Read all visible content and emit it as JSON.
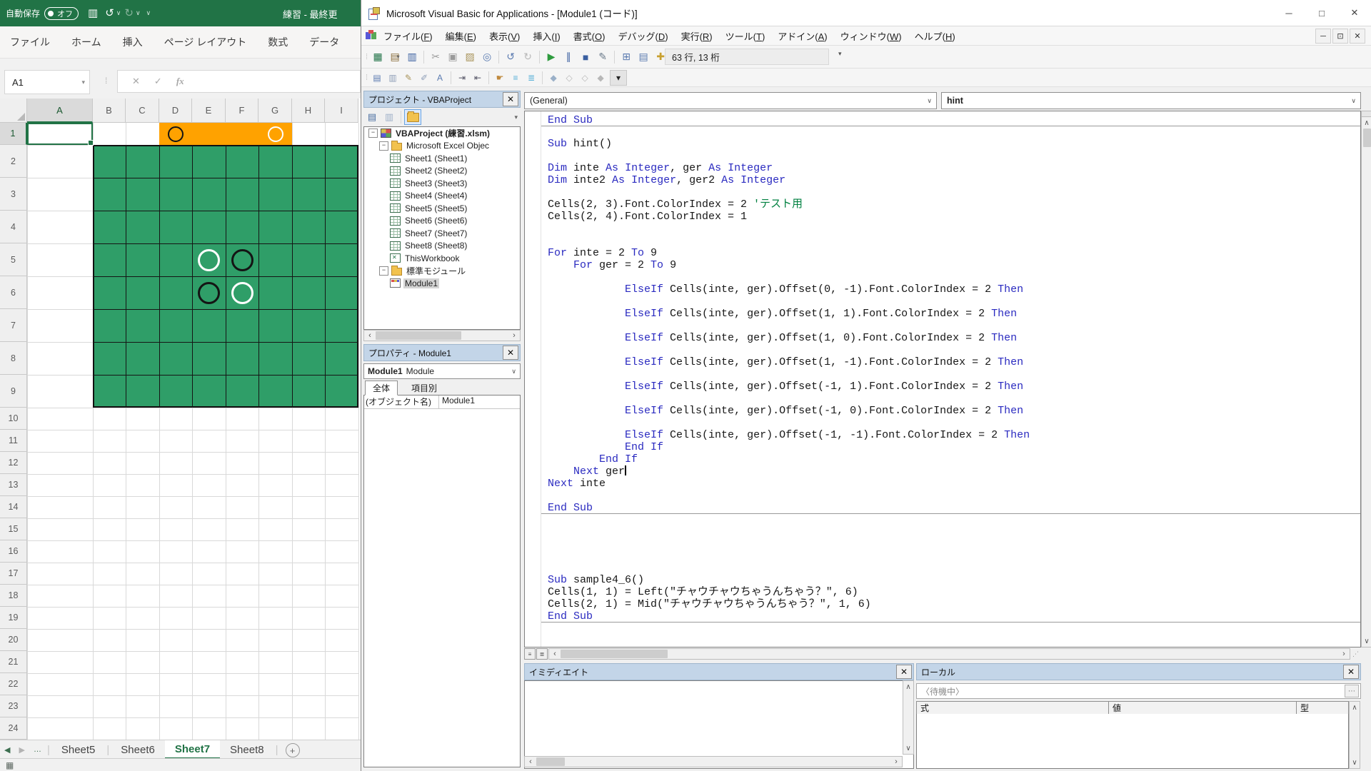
{
  "glyphs": {
    "dropdown": "▾",
    "chev_up": "∧",
    "chev_down": "∨",
    "chev_left": "‹",
    "chev_right": "›",
    "tri_left": "◀",
    "tri_right": "▶",
    "ellipsis": "…",
    "minus": "−",
    "x": "✕",
    "minimize": "─",
    "maximize": "□",
    "restore": "⊡",
    "more": "⋯"
  },
  "excel": {
    "titlebar": {
      "autosave_label": "自動保存",
      "autosave_state": "オフ",
      "title": "練習 - 最終更",
      "icons": [
        {
          "name": "save-icon",
          "glyph": "▥"
        },
        {
          "name": "undo-icon",
          "glyph": "↺"
        },
        {
          "name": "redo-icon",
          "glyph": "↻"
        },
        {
          "name": "toolbar-options-icon",
          "glyph": "▾"
        }
      ]
    },
    "ribbon_tabs": [
      "ファイル",
      "ホーム",
      "挿入",
      "ページ レイアウト",
      "数式",
      "データ"
    ],
    "name_box": "A1",
    "formula_buttons": {
      "cancel": "✕",
      "enter": "✓",
      "fx": "fx"
    },
    "columns": [
      "A",
      "B",
      "C",
      "D",
      "E",
      "F",
      "G",
      "H",
      "I"
    ],
    "row_labels": [
      "1",
      "2",
      "3",
      "4",
      "5",
      "6",
      "7",
      "8",
      "9",
      "10",
      "11",
      "12",
      "13",
      "14",
      "15",
      "16",
      "17",
      "18",
      "19",
      "20",
      "21",
      "22",
      "23",
      "24"
    ],
    "selection": "A1",
    "board": {
      "green_range": "B2:I9",
      "orange_range": "D1:G1",
      "green_color": "#2f9e68",
      "orange_color": "#ffa200",
      "discs": [
        {
          "col": "D",
          "row": 1,
          "color": "black"
        },
        {
          "col": "G",
          "row": 1,
          "color": "white"
        },
        {
          "col": "E",
          "row": 5,
          "color": "white"
        },
        {
          "col": "F",
          "row": 5,
          "color": "black"
        },
        {
          "col": "E",
          "row": 6,
          "color": "black"
        },
        {
          "col": "F",
          "row": 6,
          "color": "white"
        }
      ]
    },
    "sheet_tabs": {
      "overflow": "…",
      "tabs": [
        "Sheet5",
        "Sheet6",
        "Sheet7",
        "Sheet8"
      ],
      "active": "Sheet7"
    },
    "status_icon": "▦"
  },
  "vba": {
    "title": "Microsoft Visual Basic for Applications - [Module1 (コード)]",
    "menus": [
      "ファイル(F)",
      "編集(E)",
      "表示(V)",
      "挿入(I)",
      "書式(O)",
      "デバッグ(D)",
      "実行(R)",
      "ツール(T)",
      "アドイン(A)",
      "ウィンドウ(W)",
      "ヘルプ(H)"
    ],
    "position_indicator": "63 行, 13 桁",
    "toolbar_main": [
      {
        "name": "view-excel-icon",
        "glyph": "▦",
        "color": "#1e7145"
      },
      {
        "name": "insert-object-icon",
        "glyph": "▤",
        "color": "#8a6d3b",
        "dd": true
      },
      {
        "name": "save-icon",
        "glyph": "▥",
        "color": "#3a5fa0"
      },
      {
        "sep": true
      },
      {
        "name": "cut-icon",
        "glyph": "✂",
        "color": "#9a9a9a"
      },
      {
        "name": "copy-icon",
        "glyph": "▣",
        "color": "#9a9a9a"
      },
      {
        "name": "paste-icon",
        "glyph": "▨",
        "color": "#a8935a"
      },
      {
        "name": "find-icon",
        "glyph": "◎",
        "color": "#5a7ab0"
      },
      {
        "sep": true
      },
      {
        "name": "undo-icon",
        "glyph": "↺",
        "color": "#5a7ab0"
      },
      {
        "name": "redo-icon",
        "glyph": "↻",
        "color": "#b8b8b8"
      },
      {
        "sep": true
      },
      {
        "name": "run-icon",
        "glyph": "▶",
        "color": "#2e9b3e"
      },
      {
        "name": "break-icon",
        "glyph": "∥",
        "color": "#3a5fa0"
      },
      {
        "name": "reset-icon",
        "glyph": "■",
        "color": "#3a5fa0"
      },
      {
        "name": "design-mode-icon",
        "glyph": "✎",
        "color": "#6a7a8a"
      },
      {
        "sep": true
      },
      {
        "name": "project-explorer-icon",
        "glyph": "⊞",
        "color": "#5a7ab0"
      },
      {
        "name": "properties-window-icon",
        "glyph": "▤",
        "color": "#5a7ab0"
      },
      {
        "name": "toolbox-icon",
        "glyph": "✚",
        "color": "#c8a030"
      },
      {
        "name": "object-browser-icon",
        "glyph": "✦",
        "color": "#b8b8b8"
      },
      {
        "sep": true
      },
      {
        "name": "help-icon",
        "glyph": "?",
        "round": true
      }
    ],
    "toolbar_edit": [
      {
        "name": "list-properties-icon",
        "glyph": "▤",
        "color": "#5a7ab0"
      },
      {
        "name": "list-constants-icon",
        "glyph": "▥",
        "color": "#8f9fb8"
      },
      {
        "name": "quick-info-icon",
        "glyph": "✎",
        "color": "#a8935a"
      },
      {
        "name": "parameter-info-icon",
        "glyph": "✐",
        "color": "#8f9fb8"
      },
      {
        "name": "complete-word-icon",
        "glyph": "A",
        "color": "#5a7ab0"
      },
      {
        "sep": true
      },
      {
        "name": "indent-icon",
        "glyph": "⇥",
        "color": "#556"
      },
      {
        "name": "outdent-icon",
        "glyph": "⇤",
        "color": "#556"
      },
      {
        "sep": true
      },
      {
        "name": "toggle-breakpoint-icon",
        "glyph": "☛",
        "color": "#c08a3e"
      },
      {
        "name": "comment-block-icon",
        "glyph": "≡",
        "color": "#58b0d8"
      },
      {
        "name": "uncomment-block-icon",
        "glyph": "≣",
        "color": "#58b0d8"
      },
      {
        "sep": true
      },
      {
        "name": "toggle-bookmark-icon",
        "glyph": "◆",
        "color": "#9ab0c8"
      },
      {
        "name": "next-bookmark-icon",
        "glyph": "◇",
        "color": "#b8b8b8"
      },
      {
        "name": "prev-bookmark-icon",
        "glyph": "◇",
        "color": "#b8b8b8"
      },
      {
        "name": "clear-bookmarks-icon",
        "glyph": "◆",
        "color": "#b8b8b8"
      }
    ],
    "project": {
      "title": "プロジェクト - VBAProject",
      "tree": [
        {
          "depth": 0,
          "icon": "project",
          "label": "VBAProject (練習.xlsm)",
          "expander": true,
          "bold": true
        },
        {
          "depth": 1,
          "icon": "folder",
          "label": "Microsoft Excel Objec",
          "expander": true
        },
        {
          "depth": 2,
          "icon": "sheet",
          "label": "Sheet1 (Sheet1)"
        },
        {
          "depth": 2,
          "icon": "sheet",
          "label": "Sheet2 (Sheet2)"
        },
        {
          "depth": 2,
          "icon": "sheet",
          "label": "Sheet3 (Sheet3)"
        },
        {
          "depth": 2,
          "icon": "sheet",
          "label": "Sheet4 (Sheet4)"
        },
        {
          "depth": 2,
          "icon": "sheet",
          "label": "Sheet5 (Sheet5)"
        },
        {
          "depth": 2,
          "icon": "sheet",
          "label": "Sheet6 (Sheet6)"
        },
        {
          "depth": 2,
          "icon": "sheet",
          "label": "Sheet7 (Sheet7)"
        },
        {
          "depth": 2,
          "icon": "sheet",
          "label": "Sheet8 (Sheet8)"
        },
        {
          "depth": 2,
          "icon": "wb",
          "label": "ThisWorkbook"
        },
        {
          "depth": 1,
          "icon": "folder",
          "label": "標準モジュール",
          "expander": true
        },
        {
          "depth": 2,
          "icon": "module",
          "label": "Module1",
          "selected": true
        }
      ]
    },
    "properties": {
      "title": "プロパティ - Module1",
      "selector_bold": "Module1",
      "selector_rest": "Module",
      "tabs": [
        "全体",
        "項目別"
      ],
      "rows": [
        {
          "name": "(オブジェクト名)",
          "value": "Module1"
        }
      ]
    },
    "code": {
      "left_combo": "(General)",
      "right_combo": "hint",
      "lines": [
        {
          "toks": [
            [
              "k",
              "End Sub"
            ]
          ],
          "sep": true
        },
        {
          "toks": []
        },
        {
          "toks": [
            [
              "k",
              "Sub"
            ],
            [
              "t",
              " hint()"
            ]
          ]
        },
        {
          "toks": []
        },
        {
          "toks": [
            [
              "k",
              "Dim"
            ],
            [
              "t",
              " inte "
            ],
            [
              "k",
              "As"
            ],
            [
              "t",
              " "
            ],
            [
              "k",
              "Integer"
            ],
            [
              "t",
              ", ger "
            ],
            [
              "k",
              "As"
            ],
            [
              "t",
              " "
            ],
            [
              "k",
              "Integer"
            ]
          ]
        },
        {
          "toks": [
            [
              "k",
              "Dim"
            ],
            [
              "t",
              " inte2 "
            ],
            [
              "k",
              "As"
            ],
            [
              "t",
              " "
            ],
            [
              "k",
              "Integer"
            ],
            [
              "t",
              ", ger2 "
            ],
            [
              "k",
              "As"
            ],
            [
              "t",
              " "
            ],
            [
              "k",
              "Integer"
            ]
          ]
        },
        {
          "toks": []
        },
        {
          "toks": [
            [
              "t",
              "Cells(2, 3).Font.ColorIndex = 2 "
            ],
            [
              "c",
              "'テスト用"
            ]
          ]
        },
        {
          "toks": [
            [
              "t",
              "Cells(2, 4).Font.ColorIndex = 1"
            ]
          ]
        },
        {
          "toks": []
        },
        {
          "toks": []
        },
        {
          "toks": [
            [
              "k",
              "For"
            ],
            [
              "t",
              " inte = 2 "
            ],
            [
              "k",
              "To"
            ],
            [
              "t",
              " 9"
            ]
          ]
        },
        {
          "toks": [
            [
              "t",
              "    "
            ],
            [
              "k",
              "For"
            ],
            [
              "t",
              " ger = 2 "
            ],
            [
              "k",
              "To"
            ],
            [
              "t",
              " 9"
            ]
          ]
        },
        {
          "toks": []
        },
        {
          "toks": [
            [
              "t",
              "            "
            ],
            [
              "k",
              "ElseIf"
            ],
            [
              "t",
              " Cells(inte, ger).Offset(0, -1).Font.ColorIndex = 2 "
            ],
            [
              "k",
              "Then"
            ]
          ]
        },
        {
          "toks": []
        },
        {
          "toks": [
            [
              "t",
              "            "
            ],
            [
              "k",
              "ElseIf"
            ],
            [
              "t",
              " Cells(inte, ger).Offset(1, 1).Font.ColorIndex = 2 "
            ],
            [
              "k",
              "Then"
            ]
          ]
        },
        {
          "toks": []
        },
        {
          "toks": [
            [
              "t",
              "            "
            ],
            [
              "k",
              "ElseIf"
            ],
            [
              "t",
              " Cells(inte, ger).Offset(1, 0).Font.ColorIndex = 2 "
            ],
            [
              "k",
              "Then"
            ]
          ]
        },
        {
          "toks": []
        },
        {
          "toks": [
            [
              "t",
              "            "
            ],
            [
              "k",
              "ElseIf"
            ],
            [
              "t",
              " Cells(inte, ger).Offset(1, -1).Font.ColorIndex = 2 "
            ],
            [
              "k",
              "Then"
            ]
          ]
        },
        {
          "toks": []
        },
        {
          "toks": [
            [
              "t",
              "            "
            ],
            [
              "k",
              "ElseIf"
            ],
            [
              "t",
              " Cells(inte, ger).Offset(-1, 1).Font.ColorIndex = 2 "
            ],
            [
              "k",
              "Then"
            ]
          ]
        },
        {
          "toks": []
        },
        {
          "toks": [
            [
              "t",
              "            "
            ],
            [
              "k",
              "ElseIf"
            ],
            [
              "t",
              " Cells(inte, ger).Offset(-1, 0).Font.ColorIndex = 2 "
            ],
            [
              "k",
              "Then"
            ]
          ]
        },
        {
          "toks": []
        },
        {
          "toks": [
            [
              "t",
              "            "
            ],
            [
              "k",
              "ElseIf"
            ],
            [
              "t",
              " Cells(inte, ger).Offset(-1, -1).Font.ColorIndex = 2 "
            ],
            [
              "k",
              "Then"
            ]
          ]
        },
        {
          "toks": [
            [
              "t",
              "            "
            ],
            [
              "k",
              "End If"
            ]
          ]
        },
        {
          "toks": [
            [
              "t",
              "        "
            ],
            [
              "k",
              "End If"
            ]
          ]
        },
        {
          "toks": [
            [
              "t",
              "    "
            ],
            [
              "k",
              "Next"
            ],
            [
              "t",
              " ger"
            ]
          ],
          "caret": true
        },
        {
          "toks": [
            [
              "k",
              "Next"
            ],
            [
              "t",
              " inte"
            ]
          ]
        },
        {
          "toks": []
        },
        {
          "toks": [
            [
              "k",
              "End Sub"
            ]
          ],
          "sep": true
        },
        {
          "toks": []
        },
        {
          "toks": []
        },
        {
          "toks": []
        },
        {
          "toks": []
        },
        {
          "toks": []
        },
        {
          "toks": [
            [
              "k",
              "Sub"
            ],
            [
              "t",
              " sample4_6()"
            ]
          ]
        },
        {
          "toks": [
            [
              "t",
              "Cells(1, 1) = Left(\"チャウチャウちゃうんちゃう？\", 6)"
            ]
          ]
        },
        {
          "toks": [
            [
              "t",
              "Cells(2, 1) = Mid(\"チャウチャウちゃうんちゃう？\", 1, 6)"
            ]
          ]
        },
        {
          "toks": [
            [
              "k",
              "End Sub"
            ]
          ],
          "sep": true
        }
      ]
    },
    "immediate": {
      "title": "イミディエイト"
    },
    "locals": {
      "title": "ローカル",
      "status": "〈待機中〉",
      "columns": [
        "式",
        "値",
        "型"
      ]
    }
  },
  "colors": {
    "excel_green": "#217346",
    "board_green": "#2f9e68",
    "board_orange": "#ffa200",
    "keyword_blue": "#2a2ac0",
    "comment_green": "#008040",
    "panel_header_blue": "#c3d5e8"
  }
}
